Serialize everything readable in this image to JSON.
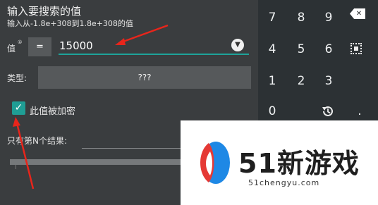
{
  "dialog": {
    "title": "输入要搜索的值",
    "range_hint": "输入从-1.8e+308到1.8e+308的值",
    "value_label": "值",
    "value_info_marker": "①",
    "operator": "=",
    "value": "15000",
    "dropdown_glyph": "▼",
    "type_label": "类型:",
    "type_value": "???",
    "encrypted_checked": true,
    "encrypted_label": "此值被加密",
    "nth_result_label": "只有第N个结果:"
  },
  "keypad": {
    "keys": [
      "7",
      "8",
      "9",
      "4",
      "5",
      "6",
      "1",
      "2",
      "3",
      "0",
      "."
    ]
  },
  "watermark": {
    "brand": "51新游戏",
    "url": "51chengyu.com"
  },
  "colors": {
    "accent_teal": "#1ea39a",
    "annotation_red": "#e8251b",
    "dialog_bg": "#3a3d3f",
    "keypad_bg": "#2c3134"
  }
}
